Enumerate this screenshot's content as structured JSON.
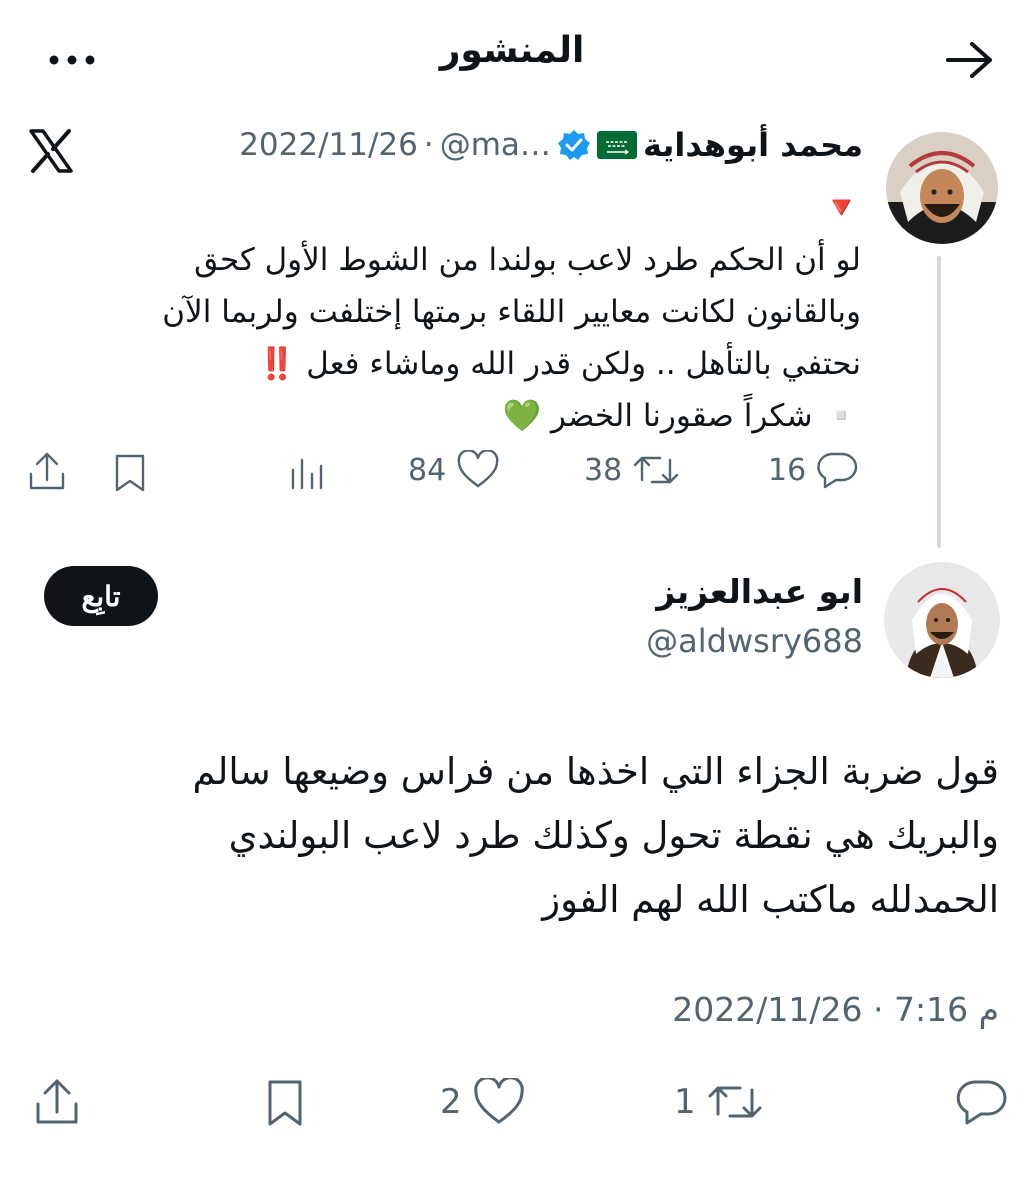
{
  "header": {
    "title": "المنشور"
  },
  "quoted_tweet": {
    "author_name": "محمد أبوهداية",
    "handle": "@ma…",
    "date": "2022/11/26",
    "separator": "·",
    "text_lines": [
      "🔻",
      "لو أن الحكم طرد لاعب بولندا من الشوط الأول كحق",
      "وبالقانون لكانت معايير اللقاء برمتها إختلفت ولربما الآن",
      "نحتفي بالتأهل .. ولكن قدر الله وماشاء فعل ‼️",
      "▫️ شكراً صقورنا الخضر 💚"
    ],
    "stats": {
      "replies": "16",
      "reposts": "38",
      "likes": "84"
    }
  },
  "main_tweet": {
    "author_name": "ابو عبدالعزيز",
    "handle": "@aldwsry688",
    "follow_label": "تابِع",
    "text_lines": [
      "قول ضربة الجزاء التي اخذها من فراس وضيعها سالم",
      "والبريك هي نقطة تحول وكذلك طرد لاعب البولندي",
      "الحمدلله ماكتب الله لهم الفوز"
    ],
    "timestamp": "2022/11/26 · 7:16 م",
    "stats": {
      "replies": "",
      "reposts": "1",
      "likes": "2"
    }
  },
  "colors": {
    "text": "#0f1419",
    "secondary": "#536471",
    "verified": "#1d9bf0",
    "flag_green": "#006c35",
    "follow_bg": "#0f1419"
  },
  "icons": [
    "back-arrow-icon",
    "more-icon",
    "x-logo-icon",
    "verified-badge-icon",
    "saudi-flag-icon",
    "reply-icon",
    "repost-icon",
    "like-icon",
    "analytics-icon",
    "bookmark-icon",
    "share-icon"
  ]
}
